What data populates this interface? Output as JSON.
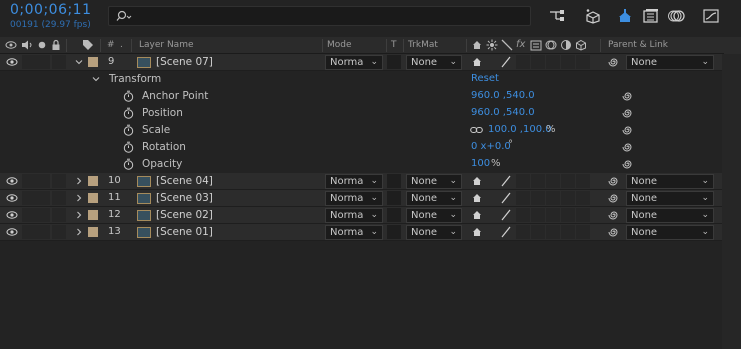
{
  "timecode": "0;00;06;11",
  "frame_info": "00191 (29.97 fps)",
  "search": {
    "placeholder": ""
  },
  "toolbar_icons": [
    "comp-flowchart-icon",
    "draft-3d-icon",
    "shy-layers-icon",
    "frame-blending-icon",
    "motion-blur-icon",
    "graph-editor-icon"
  ],
  "columns": {
    "hash": "#",
    "layer_name": "Layer Name",
    "mode": "Mode",
    "t": "T",
    "trkmat": "TrkMat",
    "fx": "fx",
    "parent": "Parent & Link"
  },
  "colors": {
    "accent": "#3d8ee0",
    "label": "#b7a07e",
    "bg": "#232323"
  },
  "layers": [
    {
      "num": "9",
      "name": "[Scene 07]",
      "mode": "Norma",
      "trkmat": "None",
      "parent": "None",
      "expanded": true
    },
    {
      "num": "10",
      "name": "[Scene 04]",
      "mode": "Norma",
      "trkmat": "None",
      "parent": "None",
      "expanded": false
    },
    {
      "num": "11",
      "name": "[Scene 03]",
      "mode": "Norma",
      "trkmat": "None",
      "parent": "None",
      "expanded": false
    },
    {
      "num": "12",
      "name": "[Scene 02]",
      "mode": "Norma",
      "trkmat": "None",
      "parent": "None",
      "expanded": false
    },
    {
      "num": "13",
      "name": "[Scene 01]",
      "mode": "Norma",
      "trkmat": "None",
      "parent": "None",
      "expanded": false
    }
  ],
  "transform": {
    "label": "Transform",
    "reset": "Reset",
    "props": [
      {
        "name": "Anchor Point",
        "value": "960.0 ,540.0",
        "unit": ""
      },
      {
        "name": "Position",
        "value": "960.0 ,540.0",
        "unit": ""
      },
      {
        "name": "Scale",
        "value": "100.0 ,100.0",
        "unit": "%"
      },
      {
        "name": "Rotation",
        "value": "0 x+0.0",
        "unit": "°"
      },
      {
        "name": "Opacity",
        "value": "100",
        "unit": "%"
      }
    ]
  }
}
